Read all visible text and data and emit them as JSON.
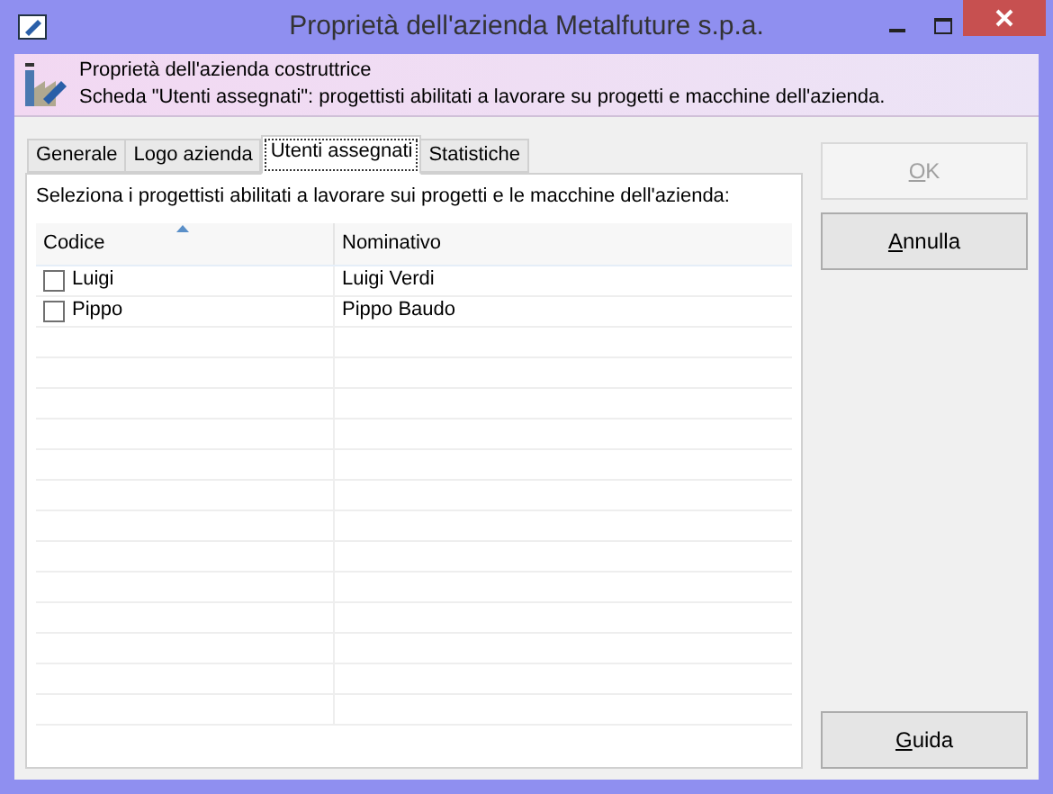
{
  "window": {
    "title": "Proprietà dell'azienda Metalfuture s.p.a."
  },
  "header": {
    "title": "Proprietà dell'azienda costruttrice",
    "description": "Scheda \"Utenti assegnati\": progettisti abilitati a lavorare su progetti e macchine dell'azienda."
  },
  "tabs": [
    {
      "label": "Generale",
      "selected": false
    },
    {
      "label": "Logo azienda",
      "selected": false
    },
    {
      "label": "Utenti assegnati",
      "selected": true
    },
    {
      "label": "Statistiche",
      "selected": false
    }
  ],
  "instruction": "Seleziona i progettisti abilitati a lavorare sui progetti e le macchine dell'azienda:",
  "table": {
    "columns": [
      {
        "label": "Codice",
        "sorted": true
      },
      {
        "label": "Nominativo",
        "sorted": false
      }
    ],
    "rows": [
      {
        "checked": false,
        "codice": "Luigi",
        "nominativo": "Luigi Verdi"
      },
      {
        "checked": false,
        "codice": "Pippo",
        "nominativo": "Pippo Baudo"
      }
    ]
  },
  "buttons": [
    {
      "label": "OK",
      "disabled": true,
      "underline_first": true
    },
    {
      "label": "Annulla",
      "disabled": false,
      "underline_first": true
    },
    {
      "label": "Guida",
      "disabled": false,
      "underline_first": true
    }
  ]
}
